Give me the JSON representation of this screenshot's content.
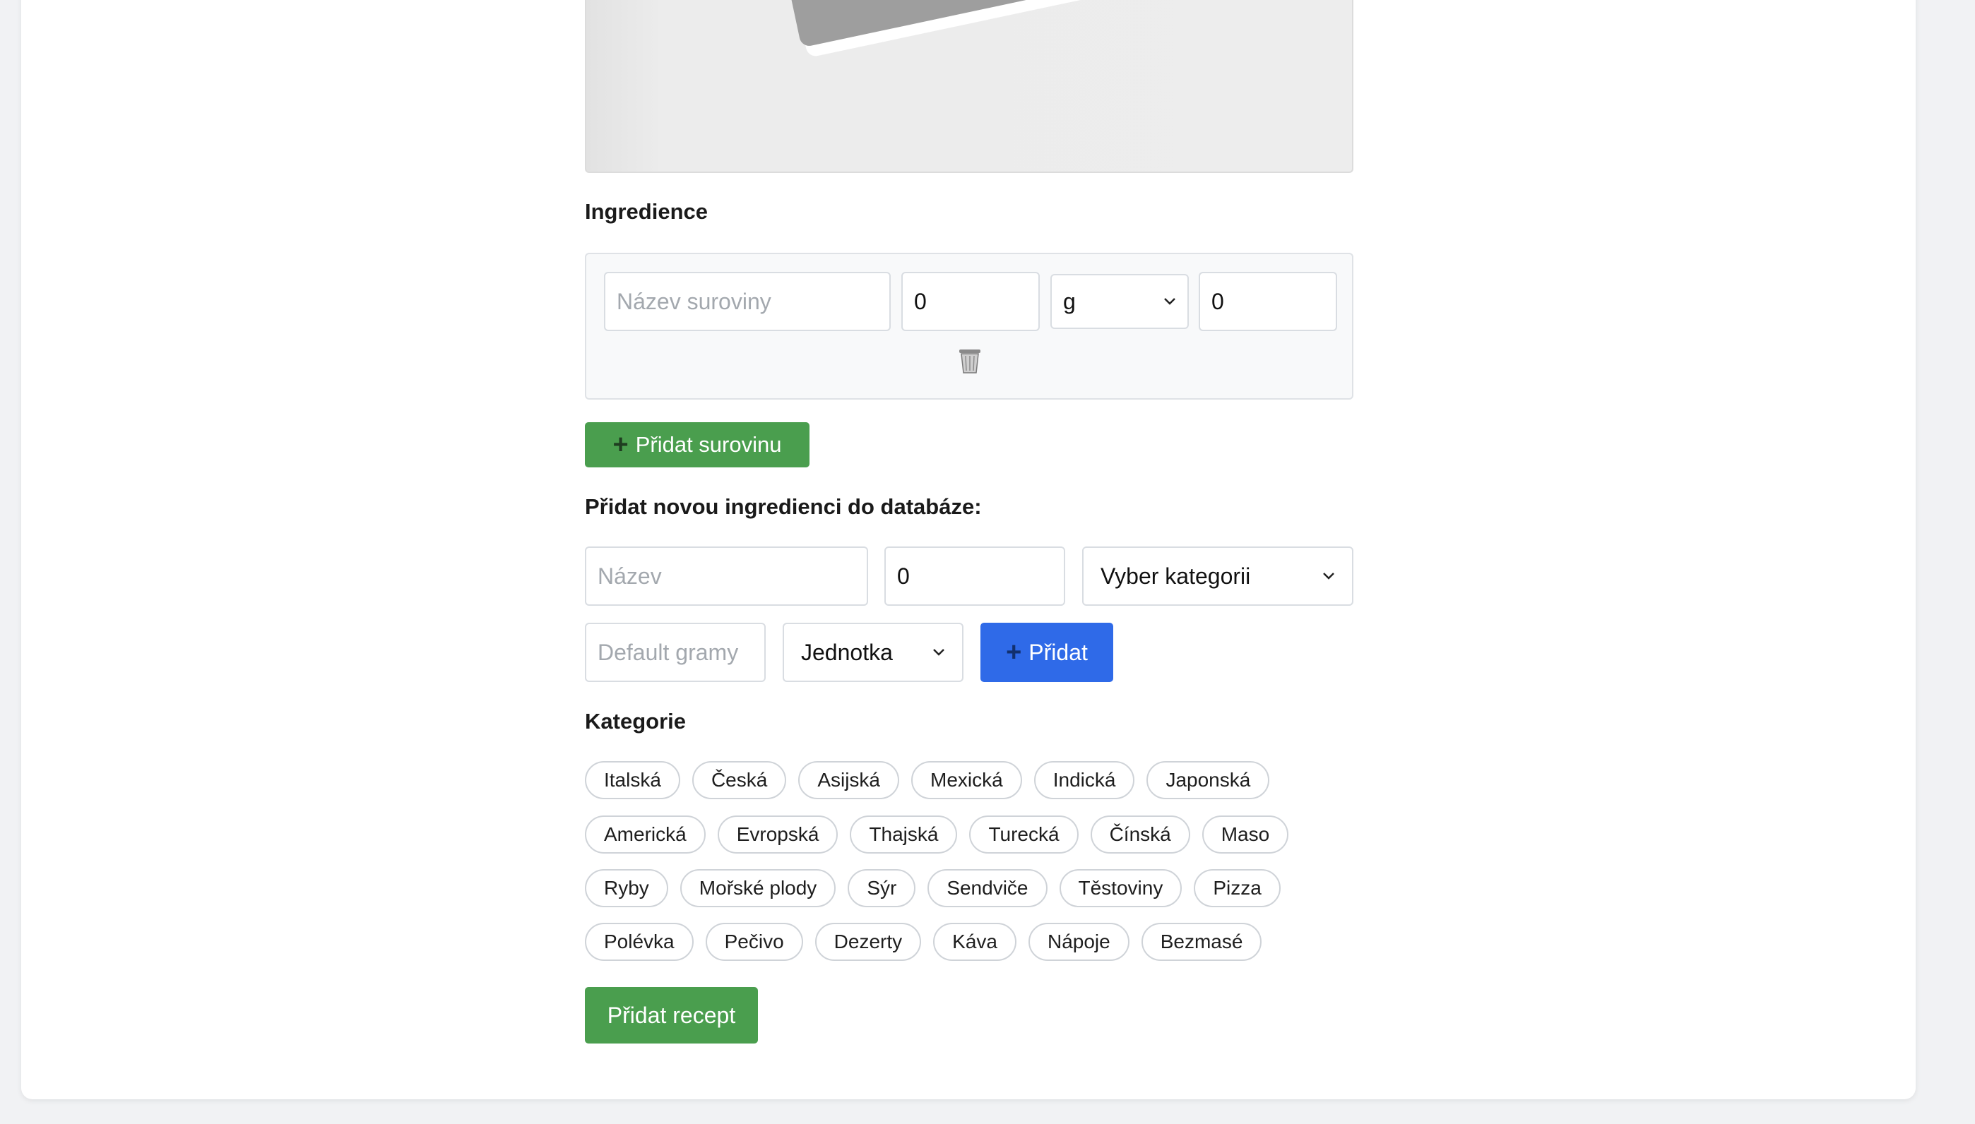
{
  "ingredients_section": {
    "heading": "Ingredience",
    "row": {
      "name_placeholder": "Název suroviny",
      "amount_value": "0",
      "unit_value": "g",
      "grams_value": "0"
    },
    "add_button_label": "Přidat surovinu"
  },
  "new_ingredient_section": {
    "heading": "Přidat novou ingredienci do databáze:",
    "name_placeholder": "Název",
    "value_field": "0",
    "category_select": "Vyber kategorii",
    "default_grams_placeholder": "Default gramy",
    "unit_select": "Jednotka",
    "add_button_label": "Přidat"
  },
  "categories_section": {
    "heading": "Kategorie",
    "rows": [
      [
        "Italská",
        "Česká",
        "Asijská",
        "Mexická",
        "Indická",
        "Japonská"
      ],
      [
        "Americká",
        "Evropská",
        "Thajská",
        "Turecká",
        "Čínská",
        "Maso"
      ],
      [
        "Ryby",
        "Mořské plody",
        "Sýr",
        "Sendviče",
        "Těstoviny",
        "Pizza"
      ],
      [
        "Polévka",
        "Pečivo",
        "Dezerty",
        "Káva",
        "Nápoje",
        "Bezmasé"
      ]
    ]
  },
  "submit_button_label": "Přidat recept",
  "icons": {
    "image_placeholder": "image-placeholder-icon",
    "trash": "trash-icon",
    "plus": "plus-icon",
    "chevron": "chevron-down-icon"
  },
  "colors": {
    "green_button": "#4a9e4e",
    "blue_button": "#2f6ae8",
    "panel_bg": "#f8f9fa",
    "page_bg": "#f1f2f4"
  }
}
